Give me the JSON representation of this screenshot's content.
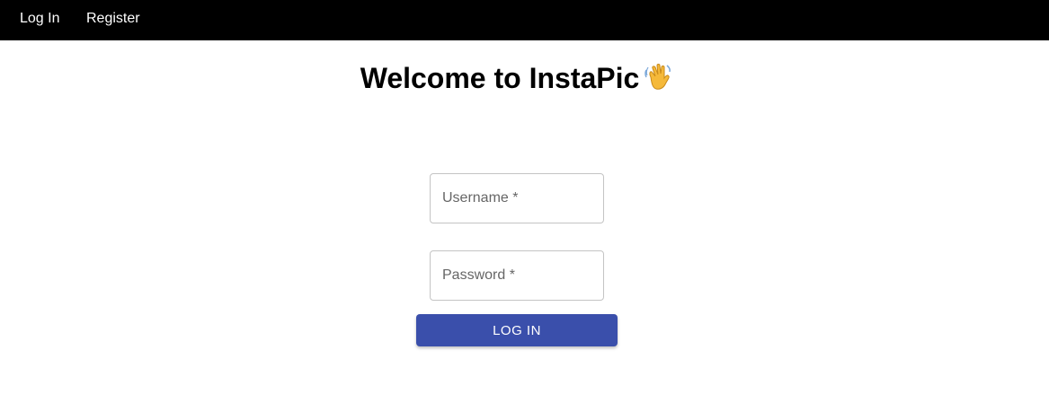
{
  "nav": {
    "login_label": "Log In",
    "register_label": "Register"
  },
  "heading": {
    "title": "Welcome to InstaPic",
    "icon": "waving-hand-icon"
  },
  "form": {
    "username_placeholder": "Username *",
    "password_placeholder": "Password *",
    "username_value": "",
    "password_value": "",
    "submit_label": "LOG IN"
  },
  "colors": {
    "navbar_bg": "#000000",
    "button_bg": "#3a4fab",
    "field_border": "#c4c4c4"
  }
}
